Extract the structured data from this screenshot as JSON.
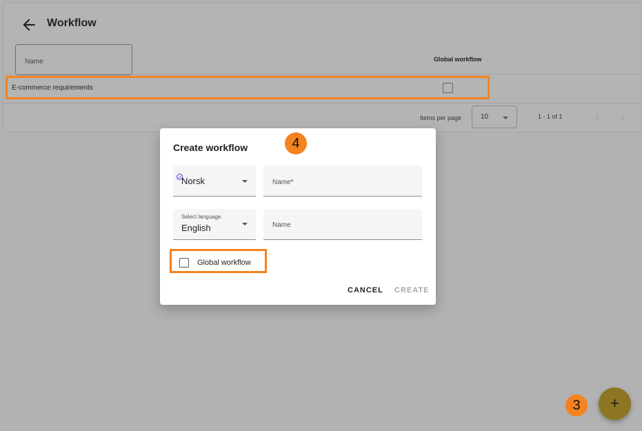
{
  "header": {
    "title": "Workflow",
    "back_icon": "arrow-left-icon"
  },
  "table": {
    "filter_placeholder": "Name",
    "columns": {
      "global_workflow": "Global workflow"
    },
    "rows": [
      {
        "name": "E-commerce requirements",
        "global": false
      }
    ],
    "pagination": {
      "items_per_page_label": "Items per page",
      "page_size": "10",
      "range": "1 - 1 of 1"
    }
  },
  "dialog": {
    "title": "Create workflow",
    "primary_language": "Norsk",
    "name_required_label": "Name*",
    "select_language_label": "Select language",
    "secondary_language": "English",
    "name_label": "Name",
    "global_checkbox_label": "Global workflow",
    "global_checked": false,
    "cancel_label": "CANCEL",
    "create_label": "CREATE"
  },
  "annotations": {
    "step_dialog": "4",
    "step_fab": "3"
  },
  "fab": {
    "label": "+"
  },
  "colors": {
    "highlight": "#f58220",
    "fab": "#8e7522",
    "overlay": "#b2b2b2"
  }
}
